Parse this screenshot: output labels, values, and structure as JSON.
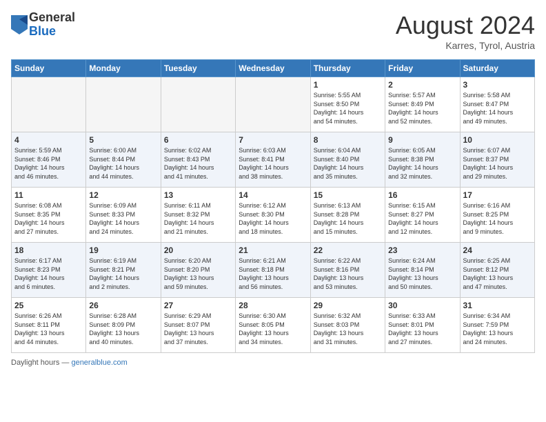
{
  "header": {
    "logo_general": "General",
    "logo_blue": "Blue",
    "month_year": "August 2024",
    "location": "Karres, Tyrol, Austria"
  },
  "days_of_week": [
    "Sunday",
    "Monday",
    "Tuesday",
    "Wednesday",
    "Thursday",
    "Friday",
    "Saturday"
  ],
  "footer": {
    "text": "Daylight hours",
    "url": "https://www.generalblue.com"
  },
  "weeks": [
    {
      "days": [
        {
          "num": "",
          "info": ""
        },
        {
          "num": "",
          "info": ""
        },
        {
          "num": "",
          "info": ""
        },
        {
          "num": "",
          "info": ""
        },
        {
          "num": "1",
          "info": "Sunrise: 5:55 AM\nSunset: 8:50 PM\nDaylight: 14 hours\nand 54 minutes."
        },
        {
          "num": "2",
          "info": "Sunrise: 5:57 AM\nSunset: 8:49 PM\nDaylight: 14 hours\nand 52 minutes."
        },
        {
          "num": "3",
          "info": "Sunrise: 5:58 AM\nSunset: 8:47 PM\nDaylight: 14 hours\nand 49 minutes."
        }
      ]
    },
    {
      "days": [
        {
          "num": "4",
          "info": "Sunrise: 5:59 AM\nSunset: 8:46 PM\nDaylight: 14 hours\nand 46 minutes."
        },
        {
          "num": "5",
          "info": "Sunrise: 6:00 AM\nSunset: 8:44 PM\nDaylight: 14 hours\nand 44 minutes."
        },
        {
          "num": "6",
          "info": "Sunrise: 6:02 AM\nSunset: 8:43 PM\nDaylight: 14 hours\nand 41 minutes."
        },
        {
          "num": "7",
          "info": "Sunrise: 6:03 AM\nSunset: 8:41 PM\nDaylight: 14 hours\nand 38 minutes."
        },
        {
          "num": "8",
          "info": "Sunrise: 6:04 AM\nSunset: 8:40 PM\nDaylight: 14 hours\nand 35 minutes."
        },
        {
          "num": "9",
          "info": "Sunrise: 6:05 AM\nSunset: 8:38 PM\nDaylight: 14 hours\nand 32 minutes."
        },
        {
          "num": "10",
          "info": "Sunrise: 6:07 AM\nSunset: 8:37 PM\nDaylight: 14 hours\nand 29 minutes."
        }
      ]
    },
    {
      "days": [
        {
          "num": "11",
          "info": "Sunrise: 6:08 AM\nSunset: 8:35 PM\nDaylight: 14 hours\nand 27 minutes."
        },
        {
          "num": "12",
          "info": "Sunrise: 6:09 AM\nSunset: 8:33 PM\nDaylight: 14 hours\nand 24 minutes."
        },
        {
          "num": "13",
          "info": "Sunrise: 6:11 AM\nSunset: 8:32 PM\nDaylight: 14 hours\nand 21 minutes."
        },
        {
          "num": "14",
          "info": "Sunrise: 6:12 AM\nSunset: 8:30 PM\nDaylight: 14 hours\nand 18 minutes."
        },
        {
          "num": "15",
          "info": "Sunrise: 6:13 AM\nSunset: 8:28 PM\nDaylight: 14 hours\nand 15 minutes."
        },
        {
          "num": "16",
          "info": "Sunrise: 6:15 AM\nSunset: 8:27 PM\nDaylight: 14 hours\nand 12 minutes."
        },
        {
          "num": "17",
          "info": "Sunrise: 6:16 AM\nSunset: 8:25 PM\nDaylight: 14 hours\nand 9 minutes."
        }
      ]
    },
    {
      "days": [
        {
          "num": "18",
          "info": "Sunrise: 6:17 AM\nSunset: 8:23 PM\nDaylight: 14 hours\nand 6 minutes."
        },
        {
          "num": "19",
          "info": "Sunrise: 6:19 AM\nSunset: 8:21 PM\nDaylight: 14 hours\nand 2 minutes."
        },
        {
          "num": "20",
          "info": "Sunrise: 6:20 AM\nSunset: 8:20 PM\nDaylight: 13 hours\nand 59 minutes."
        },
        {
          "num": "21",
          "info": "Sunrise: 6:21 AM\nSunset: 8:18 PM\nDaylight: 13 hours\nand 56 minutes."
        },
        {
          "num": "22",
          "info": "Sunrise: 6:22 AM\nSunset: 8:16 PM\nDaylight: 13 hours\nand 53 minutes."
        },
        {
          "num": "23",
          "info": "Sunrise: 6:24 AM\nSunset: 8:14 PM\nDaylight: 13 hours\nand 50 minutes."
        },
        {
          "num": "24",
          "info": "Sunrise: 6:25 AM\nSunset: 8:12 PM\nDaylight: 13 hours\nand 47 minutes."
        }
      ]
    },
    {
      "days": [
        {
          "num": "25",
          "info": "Sunrise: 6:26 AM\nSunset: 8:11 PM\nDaylight: 13 hours\nand 44 minutes."
        },
        {
          "num": "26",
          "info": "Sunrise: 6:28 AM\nSunset: 8:09 PM\nDaylight: 13 hours\nand 40 minutes."
        },
        {
          "num": "27",
          "info": "Sunrise: 6:29 AM\nSunset: 8:07 PM\nDaylight: 13 hours\nand 37 minutes."
        },
        {
          "num": "28",
          "info": "Sunrise: 6:30 AM\nSunset: 8:05 PM\nDaylight: 13 hours\nand 34 minutes."
        },
        {
          "num": "29",
          "info": "Sunrise: 6:32 AM\nSunset: 8:03 PM\nDaylight: 13 hours\nand 31 minutes."
        },
        {
          "num": "30",
          "info": "Sunrise: 6:33 AM\nSunset: 8:01 PM\nDaylight: 13 hours\nand 27 minutes."
        },
        {
          "num": "31",
          "info": "Sunrise: 6:34 AM\nSunset: 7:59 PM\nDaylight: 13 hours\nand 24 minutes."
        }
      ]
    }
  ]
}
